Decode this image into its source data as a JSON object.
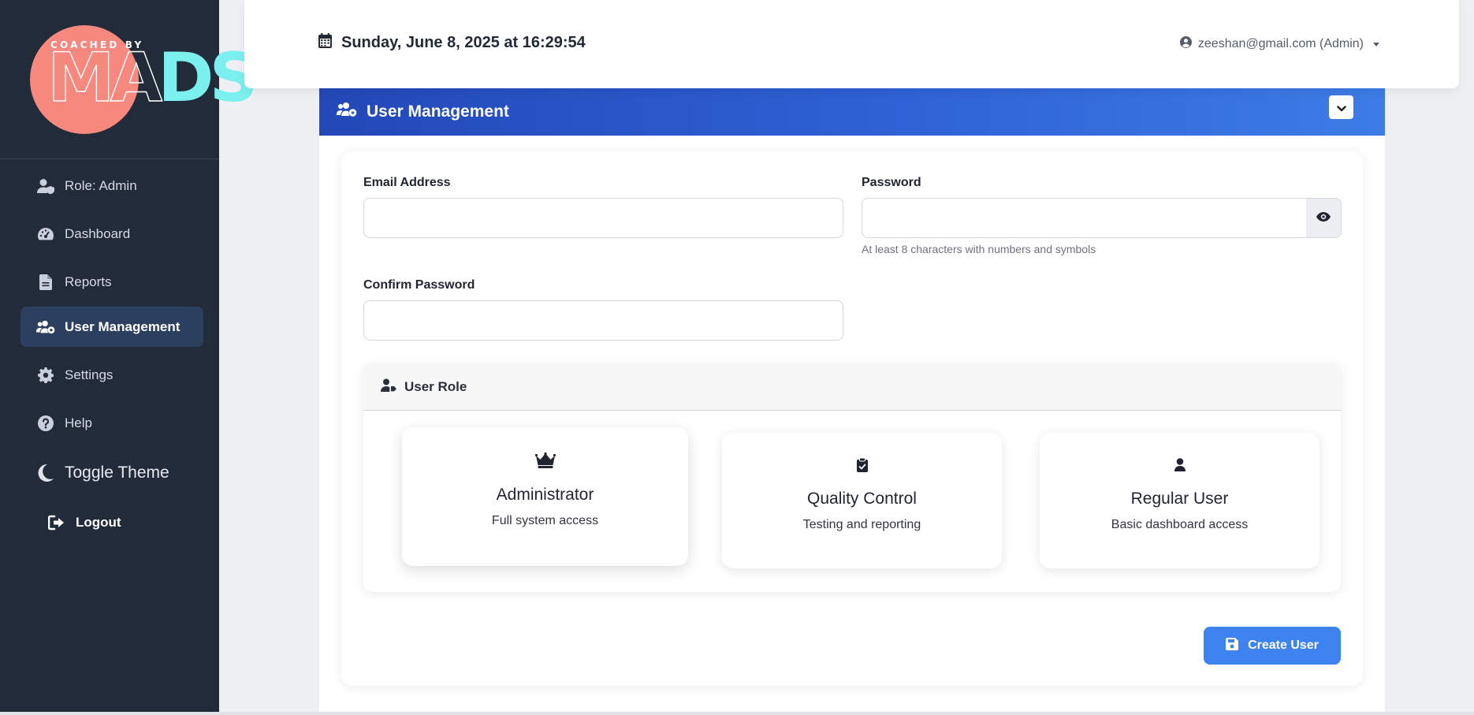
{
  "brand": {
    "tagline": "COACHED BY",
    "name_left": "MA",
    "name_right": "DS"
  },
  "sidebar": {
    "items": [
      {
        "label": "Role: Admin",
        "icon": "user-shield-icon"
      },
      {
        "label": "Dashboard",
        "icon": "gauge-icon"
      },
      {
        "label": "Reports",
        "icon": "file-icon"
      },
      {
        "label": "User Management",
        "icon": "users-cog-icon",
        "active": true
      },
      {
        "label": "Settings",
        "icon": "gear-icon"
      },
      {
        "label": "Help",
        "icon": "question-circle-icon"
      },
      {
        "label": "Toggle Theme",
        "icon": "moon-icon"
      },
      {
        "label": "Logout",
        "icon": "sign-out-icon"
      }
    ]
  },
  "header": {
    "datetime": "Sunday, June 8, 2025 at 16:29:54",
    "user": "zeeshan@gmail.com (Admin)"
  },
  "panel": {
    "title": "User Management"
  },
  "form": {
    "email_label": "Email Address",
    "email_value": "",
    "password_label": "Password",
    "password_value": "",
    "password_hint": "At least 8 characters with numbers and symbols",
    "confirm_label": "Confirm Password",
    "confirm_value": ""
  },
  "roles": {
    "heading": "User Role",
    "options": [
      {
        "title": "Administrator",
        "desc": "Full system access",
        "icon": "crown-icon",
        "selected": true
      },
      {
        "title": "Quality Control",
        "desc": "Testing and reporting",
        "icon": "clipboard-check-icon"
      },
      {
        "title": "Regular User",
        "desc": "Basic dashboard access",
        "icon": "user-icon"
      }
    ]
  },
  "actions": {
    "create_label": "Create User"
  },
  "colors": {
    "sidebar_bg": "#222b3a",
    "active_nav": "#2d3f5e",
    "header_gradient_start": "#2348b8",
    "header_gradient_end": "#3d7ce6",
    "primary_button": "#3d83f0",
    "logo_circle": "#f6887e",
    "logo_accent": "#7bf0ef"
  }
}
